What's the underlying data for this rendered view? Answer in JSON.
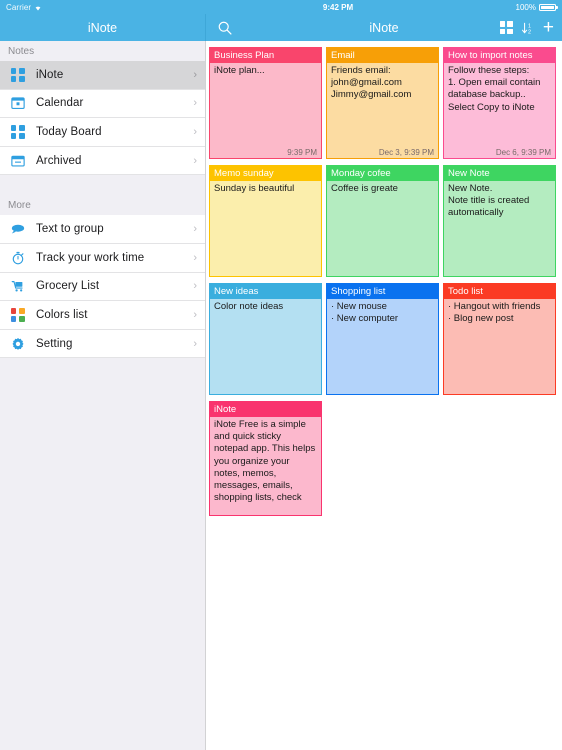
{
  "statusbar": {
    "carrier": "Carrier",
    "wifi_icon": "wifi-icon",
    "time": "9:42 PM",
    "battery_percent": "100%",
    "battery_icon": "battery-full-icon"
  },
  "nav": {
    "left_title": "iNote",
    "right_title": "iNote",
    "search_icon": "search-icon",
    "grid_icon": "grid-view-icon",
    "sort_icon": "sort-icon",
    "add_icon": "add-icon",
    "add_label": "+"
  },
  "sidebar": {
    "sections": [
      {
        "header": "Notes",
        "items": [
          {
            "label": "iNote",
            "icon": "grid-icon",
            "active": true,
            "chevron": "›"
          },
          {
            "label": "Calendar",
            "icon": "calendar-icon",
            "active": false,
            "chevron": "›"
          },
          {
            "label": "Today Board",
            "icon": "grid-icon",
            "active": false,
            "chevron": "›"
          },
          {
            "label": "Archived",
            "icon": "archive-icon",
            "active": false,
            "chevron": "›"
          }
        ]
      },
      {
        "header": "More",
        "items": [
          {
            "label": "Text to group",
            "icon": "speech-bubble-icon",
            "active": false,
            "chevron": "›"
          },
          {
            "label": "Track your work time",
            "icon": "stopwatch-icon",
            "active": false,
            "chevron": "›"
          },
          {
            "label": "Grocery List",
            "icon": "cart-icon",
            "active": false,
            "chevron": "›"
          },
          {
            "label": "Colors list",
            "icon": "color-grid-icon",
            "active": false,
            "chevron": "›"
          },
          {
            "label": "Setting",
            "icon": "gear-icon",
            "active": false,
            "chevron": "›"
          }
        ]
      }
    ]
  },
  "notes": [
    {
      "title": "Business Plan",
      "lines": [
        "iNote plan..."
      ],
      "date": "9:39 PM",
      "header_color": "#f9456c",
      "body_color": "#fcb9c9"
    },
    {
      "title": "Email",
      "lines": [
        "Friends email:",
        "john@gmail.com",
        "Jimmy@gmail.com"
      ],
      "date": "Dec 3, 9:39 PM",
      "header_color": "#f79f07",
      "body_color": "#fcdca2"
    },
    {
      "title": "How to import notes",
      "lines": [
        "Follow these steps:",
        "1. Open email contain database backup.. Select Copy to iNote"
      ],
      "date": "Dec 6, 9:39 PM",
      "header_color": "#fa4b8e",
      "body_color": "#fdbcd8"
    },
    {
      "title": "Memo sunday",
      "lines": [
        "Sunday is beautiful"
      ],
      "date": "",
      "header_color": "#fdc300",
      "body_color": "#fbeeac"
    },
    {
      "title": "Monday cofee",
      "lines": [
        "Coffee is greate"
      ],
      "date": "",
      "header_color": "#3ed561",
      "body_color": "#b4ecc0"
    },
    {
      "title": "New Note",
      "lines": [
        "New Note.",
        "Note title is created automatically"
      ],
      "date": "",
      "header_color": "#3ed561",
      "body_color": "#b4ecc0"
    },
    {
      "title": "New ideas",
      "lines": [
        "Color note ideas"
      ],
      "date": "",
      "header_color": "#3aaede",
      "body_color": "#b4e0f2"
    },
    {
      "title": "Shopping list",
      "lines": [
        "· New mouse",
        "· New computer"
      ],
      "date": "",
      "header_color": "#0a72ef",
      "body_color": "#b3d3fa"
    },
    {
      "title": "Todo list",
      "lines": [
        "· Hangout with friends",
        "· Blog new post"
      ],
      "date": "",
      "header_color": "#fb3b24",
      "body_color": "#fcbcb4"
    },
    {
      "title": "iNote",
      "lines": [
        "iNote Free is a simple and quick sticky notepad app. This  helps you organize your notes, memos, messages, emails, shopping lists, check lists and to-do lists"
      ],
      "date": "",
      "header_color": "#f9346e",
      "body_color": "#fcb8cd"
    }
  ],
  "colors": {
    "nav_blue": "#4ab3e4",
    "sidebar_bg": "#f0eff4",
    "sidebar_active": "#d6d6d8",
    "icon_blue": "#2f9fe0"
  }
}
